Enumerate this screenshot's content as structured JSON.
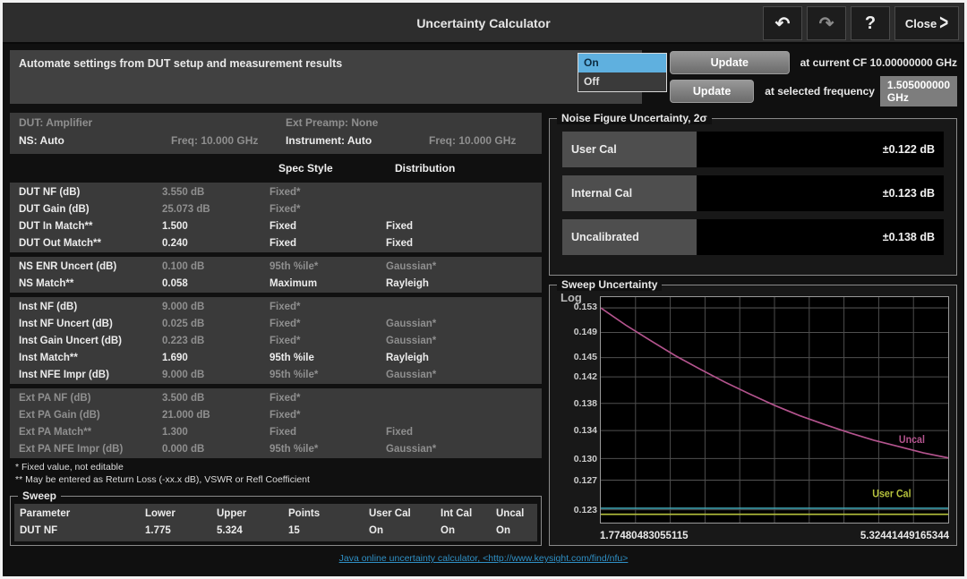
{
  "title_bar": {
    "title": "Uncertainty Calculator",
    "undo": "↶",
    "redo": "↷",
    "help": "?",
    "close_label": "Close"
  },
  "automate": {
    "label": "Automate settings from DUT setup and measurement results",
    "options": [
      "On",
      "Off"
    ],
    "selected": "On"
  },
  "update": {
    "button_label": "Update",
    "current_cf_text": "at current CF 10.00000000 GHz",
    "selected_freq_text": "at selected frequency",
    "selected_freq_value": "1.505000000 GHz"
  },
  "setup_header": {
    "dut": "DUT:  Amplifier",
    "ext_preamp": "Ext Preamp:  None",
    "ns": "NS:  Auto",
    "ns_freq": "Freq:  10.000 GHz",
    "instrument": "Instrument:  Auto",
    "inst_freq": "Freq:  10.000 GHz"
  },
  "param_table": {
    "col_spec": "Spec Style",
    "col_dist": "Distribution",
    "groups": [
      {
        "rows": [
          {
            "label": "DUT NF (dB)",
            "value": "3.550 dB",
            "spec": "Fixed*",
            "dist": "",
            "label_dim": false,
            "value_dim": true
          },
          {
            "label": "DUT Gain (dB)",
            "value": "25.073 dB",
            "spec": "Fixed*",
            "dist": "",
            "label_dim": false,
            "value_dim": true
          },
          {
            "label": "DUT In Match**",
            "value": "1.500",
            "spec": "Fixed",
            "dist": "Fixed",
            "label_dim": false,
            "value_dim": false
          },
          {
            "label": "DUT Out Match**",
            "value": "0.240",
            "spec": "Fixed",
            "dist": "Fixed",
            "label_dim": false,
            "value_dim": false
          }
        ]
      },
      {
        "rows": [
          {
            "label": "NS ENR Uncert (dB)",
            "value": "0.100 dB",
            "spec": "95th %ile*",
            "dist": "Gaussian*",
            "label_dim": false,
            "value_dim": true
          },
          {
            "label": "NS Match**",
            "value": "0.058",
            "spec": "Maximum",
            "dist": "Rayleigh",
            "label_dim": false,
            "value_dim": false
          }
        ]
      },
      {
        "rows": [
          {
            "label": "Inst NF (dB)",
            "value": "9.000 dB",
            "spec": "Fixed*",
            "dist": "",
            "label_dim": false,
            "value_dim": true
          },
          {
            "label": "Inst NF Uncert (dB)",
            "value": "0.025 dB",
            "spec": "Fixed*",
            "dist": "Gaussian*",
            "label_dim": false,
            "value_dim": true
          },
          {
            "label": "Inst Gain Uncert (dB)",
            "value": "0.223 dB",
            "spec": "Fixed*",
            "dist": "Gaussian*",
            "label_dim": false,
            "value_dim": true
          },
          {
            "label": "Inst Match**",
            "value": "1.690",
            "spec": "95th %ile",
            "dist": "Rayleigh",
            "label_dim": false,
            "value_dim": false
          },
          {
            "label": "Inst NFE Impr (dB)",
            "value": "9.000 dB",
            "spec": "95th %ile*",
            "dist": "Gaussian*",
            "label_dim": false,
            "value_dim": true
          }
        ]
      },
      {
        "rows": [
          {
            "label": "Ext PA NF (dB)",
            "value": "3.500 dB",
            "spec": "Fixed*",
            "dist": "",
            "label_dim": true,
            "value_dim": true
          },
          {
            "label": "Ext PA Gain (dB)",
            "value": "21.000 dB",
            "spec": "Fixed*",
            "dist": "",
            "label_dim": true,
            "value_dim": true
          },
          {
            "label": "Ext PA Match**",
            "value": "1.300",
            "spec": "Fixed",
            "dist": "Fixed",
            "label_dim": true,
            "value_dim": true
          },
          {
            "label": "Ext PA NFE Impr (dB)",
            "value": "0.000 dB",
            "spec": "95th %ile*",
            "dist": "Gaussian*",
            "label_dim": true,
            "value_dim": true
          }
        ]
      }
    ]
  },
  "footnotes": [
    "* Fixed value, not editable",
    "** May be entered as Return Loss (-xx.x dB), VSWR or Refl Coefficient"
  ],
  "sweep": {
    "title": "Sweep",
    "headers": [
      "Parameter",
      "Lower",
      "Upper",
      "Points",
      "User Cal",
      "Int Cal",
      "Uncal"
    ],
    "row": [
      "DUT NF",
      "1.775",
      "5.324",
      "15",
      "On",
      "On",
      "On"
    ]
  },
  "nf_uncertainty": {
    "title": "Noise Figure Uncertainty, 2σ",
    "rows": [
      {
        "label": "User Cal",
        "value": "±0.122 dB"
      },
      {
        "label": "Internal Cal",
        "value": "±0.123 dB"
      },
      {
        "label": "Uncalibrated",
        "value": "±0.138 dB"
      }
    ]
  },
  "chart_data": {
    "type": "line",
    "title": "Sweep Uncertainty",
    "scale_label": "Log",
    "xlabel_left": "1.77480483055115",
    "xlabel_right": "5.32441449165344",
    "xlim": [
      1.7748,
      5.3244
    ],
    "ylim": [
      0.1213,
      0.1548
    ],
    "yticks": [
      0.153,
      0.149,
      0.145,
      0.142,
      0.138,
      0.134,
      0.13,
      0.127,
      0.123
    ],
    "grid_columns": 10,
    "legend_position": "inline-right",
    "series": [
      {
        "name": "Uncal",
        "color": "#b4548e",
        "x": [
          1.7748,
          2.0284,
          2.282,
          2.5355,
          2.7891,
          3.0427,
          3.2962,
          3.5498,
          3.8034,
          4.0569,
          4.3105,
          4.5641,
          4.8176,
          5.0712,
          5.3244
        ],
        "y": [
          0.153,
          0.1502,
          0.1477,
          0.1453,
          0.1432,
          0.1412,
          0.1394,
          0.1377,
          0.1362,
          0.1349,
          0.1337,
          0.1326,
          0.1317,
          0.1308,
          0.1301
        ],
        "label": {
          "text": "Uncal",
          "x": 4.82,
          "y": 0.1322
        }
      },
      {
        "name": "Int Cal",
        "color": "#3f9fae",
        "x": [
          1.7748,
          5.3244
        ],
        "y": [
          0.1232,
          0.1232
        ],
        "label": null
      },
      {
        "name": "User Cal",
        "color": "#b6c23c",
        "x": [
          1.7748,
          5.3244
        ],
        "y": [
          0.1224,
          0.1224
        ],
        "label": {
          "text": "User Cal",
          "x": 4.55,
          "y": 0.1247
        }
      }
    ]
  },
  "footer_link": "Java online uncertainty calculator, <http://www.keysight.com/find/nfu>",
  "colors": {
    "accent_blue": "#5fb0df",
    "uncal_magenta": "#b4548e",
    "user_cal_yellow": "#b6c23c",
    "int_cal_teal": "#3f9fae",
    "link_blue": "#2f8fc4"
  }
}
